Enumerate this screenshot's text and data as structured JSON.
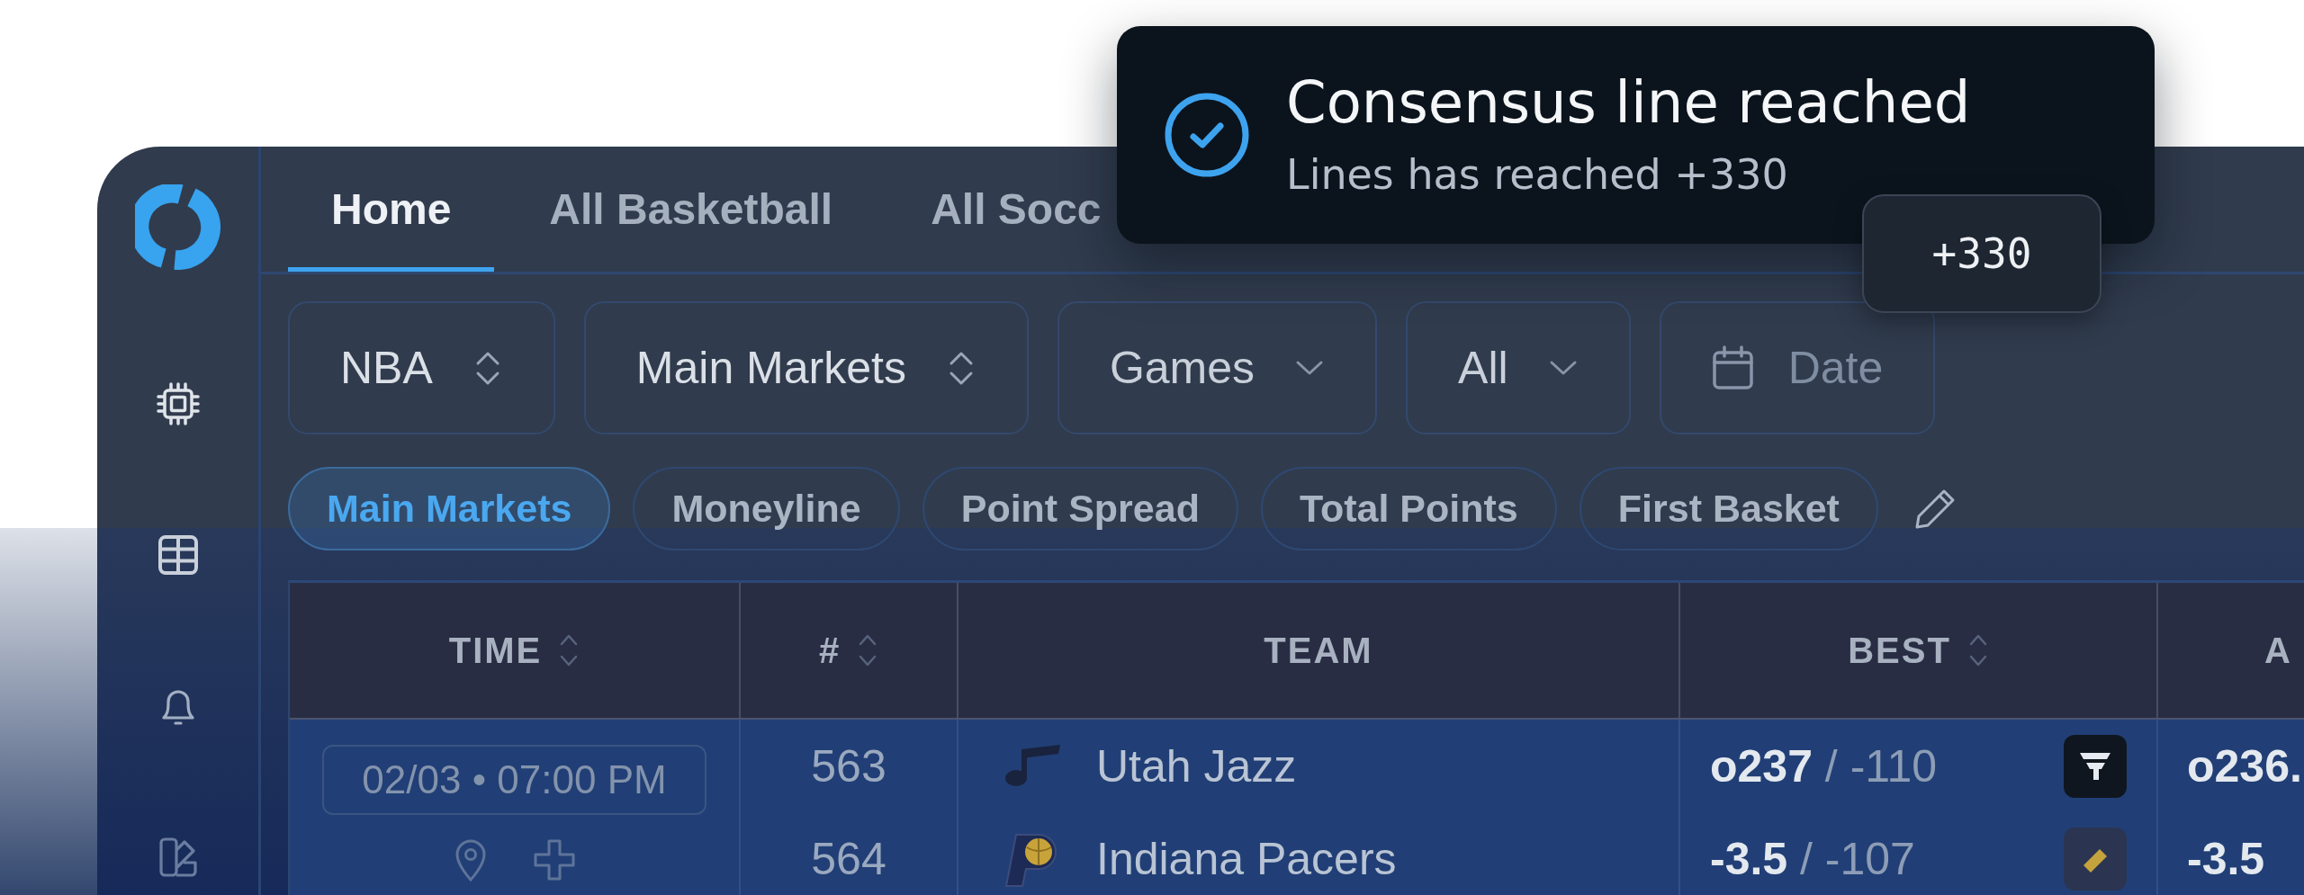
{
  "tabs": [
    {
      "label": "Home",
      "selected": true
    },
    {
      "label": "All Basketball",
      "selected": false
    },
    {
      "label": "All Socc",
      "selected": false
    }
  ],
  "filters": [
    {
      "kind": "select",
      "value": "NBA"
    },
    {
      "kind": "select",
      "value": "Main Markets"
    },
    {
      "kind": "dropdown",
      "value": "Games"
    },
    {
      "kind": "dropdown",
      "value": "All"
    },
    {
      "kind": "date",
      "placeholder": "Date"
    }
  ],
  "market_chips": [
    {
      "label": "Main Markets",
      "selected": true
    },
    {
      "label": "Moneyline",
      "selected": false
    },
    {
      "label": "Point Spread",
      "selected": false
    },
    {
      "label": "Total Points",
      "selected": false
    },
    {
      "label": "First Basket",
      "selected": false
    }
  ],
  "table": {
    "columns": [
      {
        "label": "TIME",
        "sortable": true
      },
      {
        "label": "#",
        "sortable": true
      },
      {
        "label": "TEAM",
        "sortable": false
      },
      {
        "label": "BEST",
        "sortable": true
      },
      {
        "label": "A"
      }
    ],
    "games": [
      {
        "time": "02/03 • 07:00 PM",
        "teams": [
          {
            "number": "563",
            "name": "Utah Jazz",
            "best": "**o237** / -110",
            "column_5": "o236."
          },
          {
            "number": "564",
            "name": "Indiana Pacers",
            "best": "**-3.5** / -107",
            "column_5": "-3.5"
          }
        ]
      }
    ]
  },
  "toast": {
    "title": "Consensus line reached",
    "message": "Lines has reached +330"
  },
  "tooltip": {
    "text": "+330"
  }
}
